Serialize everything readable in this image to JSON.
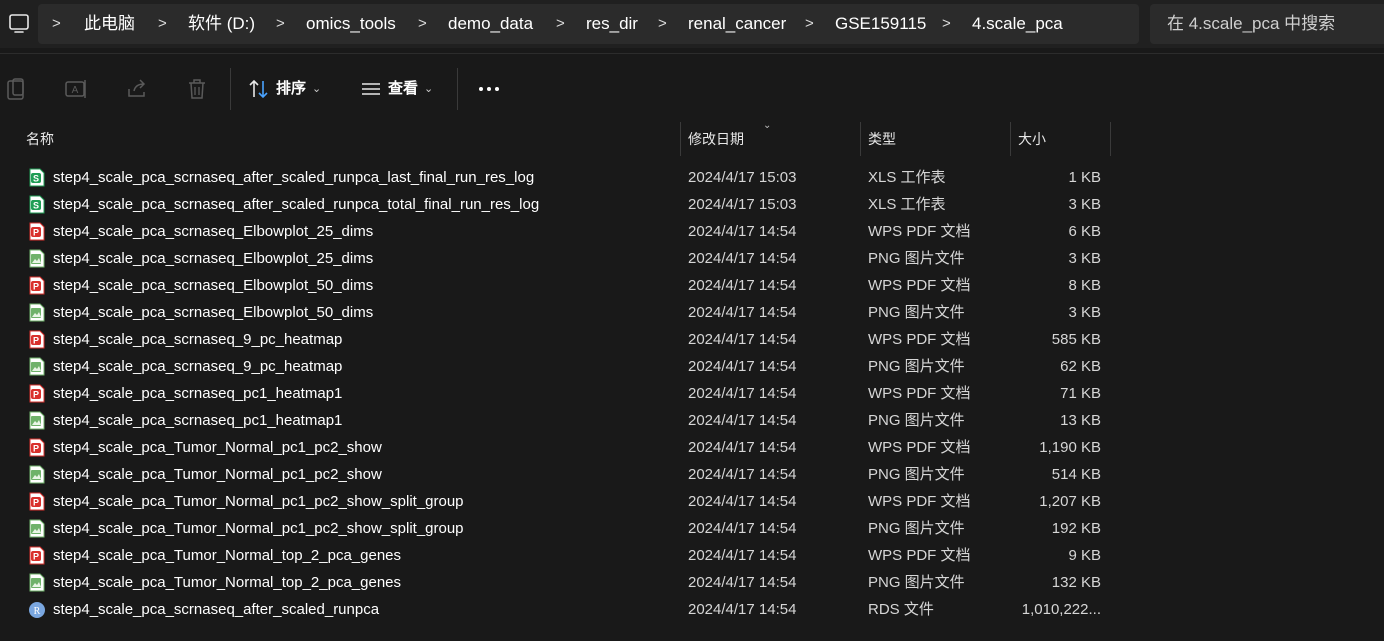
{
  "breadcrumb": [
    "此电脑",
    "软件 (D:)",
    "omics_tools",
    "demo_data",
    "res_dir",
    "renal_cancer",
    "GSE159115",
    "4.scale_pca"
  ],
  "search": {
    "placeholder": "在 4.scale_pca 中搜索"
  },
  "toolbar": {
    "sort_label": "排序",
    "view_label": "查看"
  },
  "columns": {
    "name": "名称",
    "date": "修改日期",
    "type": "类型",
    "size": "大小"
  },
  "colors": {
    "xls": "#1f9d55",
    "pdf": "#d9302c",
    "png": "#6fb26a",
    "rds": "#7aa7e0"
  },
  "files": [
    {
      "name": "step4_scale_pca_scrnaseq_after_scaled_runpca_last_final_run_res_log",
      "date": "2024/4/17 15:03",
      "type": "XLS 工作表",
      "size": "1 KB",
      "icon": "xls-file-icon"
    },
    {
      "name": "step4_scale_pca_scrnaseq_after_scaled_runpca_total_final_run_res_log",
      "date": "2024/4/17 15:03",
      "type": "XLS 工作表",
      "size": "3 KB",
      "icon": "xls-file-icon"
    },
    {
      "name": "step4_scale_pca_scrnaseq_Elbowplot_25_dims",
      "date": "2024/4/17 14:54",
      "type": "WPS PDF 文档",
      "size": "6 KB",
      "icon": "pdf-file-icon"
    },
    {
      "name": "step4_scale_pca_scrnaseq_Elbowplot_25_dims",
      "date": "2024/4/17 14:54",
      "type": "PNG 图片文件",
      "size": "3 KB",
      "icon": "png-file-icon"
    },
    {
      "name": "step4_scale_pca_scrnaseq_Elbowplot_50_dims",
      "date": "2024/4/17 14:54",
      "type": "WPS PDF 文档",
      "size": "8 KB",
      "icon": "pdf-file-icon"
    },
    {
      "name": "step4_scale_pca_scrnaseq_Elbowplot_50_dims",
      "date": "2024/4/17 14:54",
      "type": "PNG 图片文件",
      "size": "3 KB",
      "icon": "png-file-icon"
    },
    {
      "name": "step4_scale_pca_scrnaseq_9_pc_heatmap",
      "date": "2024/4/17 14:54",
      "type": "WPS PDF 文档",
      "size": "585 KB",
      "icon": "pdf-file-icon"
    },
    {
      "name": "step4_scale_pca_scrnaseq_9_pc_heatmap",
      "date": "2024/4/17 14:54",
      "type": "PNG 图片文件",
      "size": "62 KB",
      "icon": "png-file-icon"
    },
    {
      "name": "step4_scale_pca_scrnaseq_pc1_heatmap1",
      "date": "2024/4/17 14:54",
      "type": "WPS PDF 文档",
      "size": "71 KB",
      "icon": "pdf-file-icon"
    },
    {
      "name": "step4_scale_pca_scrnaseq_pc1_heatmap1",
      "date": "2024/4/17 14:54",
      "type": "PNG 图片文件",
      "size": "13 KB",
      "icon": "png-file-icon"
    },
    {
      "name": "step4_scale_pca_Tumor_Normal_pc1_pc2_show",
      "date": "2024/4/17 14:54",
      "type": "WPS PDF 文档",
      "size": "1,190 KB",
      "icon": "pdf-file-icon"
    },
    {
      "name": "step4_scale_pca_Tumor_Normal_pc1_pc2_show",
      "date": "2024/4/17 14:54",
      "type": "PNG 图片文件",
      "size": "514 KB",
      "icon": "png-file-icon"
    },
    {
      "name": "step4_scale_pca_Tumor_Normal_pc1_pc2_show_split_group",
      "date": "2024/4/17 14:54",
      "type": "WPS PDF 文档",
      "size": "1,207 KB",
      "icon": "pdf-file-icon"
    },
    {
      "name": "step4_scale_pca_Tumor_Normal_pc1_pc2_show_split_group",
      "date": "2024/4/17 14:54",
      "type": "PNG 图片文件",
      "size": "192 KB",
      "icon": "png-file-icon"
    },
    {
      "name": "step4_scale_pca_Tumor_Normal_top_2_pca_genes",
      "date": "2024/4/17 14:54",
      "type": "WPS PDF 文档",
      "size": "9 KB",
      "icon": "pdf-file-icon"
    },
    {
      "name": "step4_scale_pca_Tumor_Normal_top_2_pca_genes",
      "date": "2024/4/17 14:54",
      "type": "PNG 图片文件",
      "size": "132 KB",
      "icon": "png-file-icon"
    },
    {
      "name": "step4_scale_pca_scrnaseq_after_scaled_runpca",
      "date": "2024/4/17 14:54",
      "type": "RDS 文件",
      "size": "1,010,222...",
      "icon": "rds-file-icon"
    }
  ]
}
